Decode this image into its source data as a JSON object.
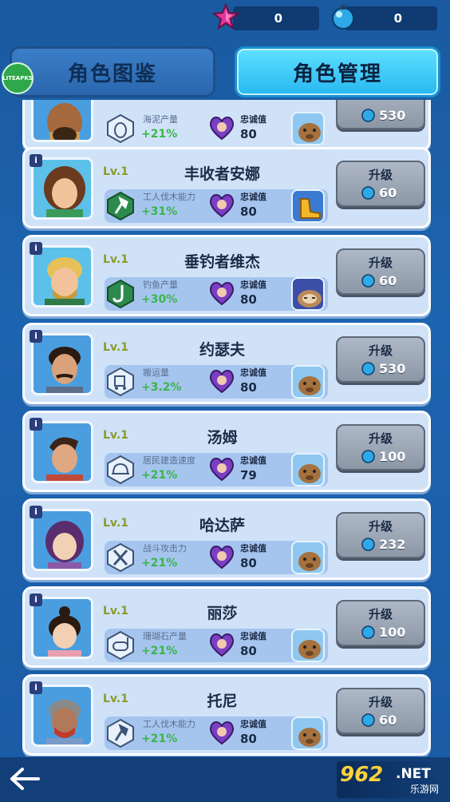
{
  "currency": {
    "stars": "0",
    "gems": "0"
  },
  "tabs": {
    "codex": "角色图鉴",
    "manage": "角色管理"
  },
  "logo": "LITEAPKS",
  "info_symbol": "i",
  "labels": {
    "loyalty": "忠诚值",
    "upgrade": "升级"
  },
  "characters": [
    {
      "level": "",
      "name": "",
      "skill": "海泥产量",
      "bonus": "+21%",
      "loyalty": "80",
      "cost": "530",
      "icon": "jar-icon",
      "pet": "capybara"
    },
    {
      "level": "Lv.1",
      "name": "丰收者安娜",
      "skill": "工人伐木能力",
      "bonus": "+31%",
      "loyalty": "80",
      "cost": "60",
      "icon": "axe-icon",
      "pet": "golden-boot"
    },
    {
      "level": "Lv.1",
      "name": "垂钓者维杰",
      "skill": "钓鱼产量",
      "bonus": "+30%",
      "loyalty": "80",
      "cost": "60",
      "icon": "fishhook-icon",
      "pet": "sloth"
    },
    {
      "level": "Lv.1",
      "name": "约瑟夫",
      "skill": "搬运量",
      "bonus": "+3.2%",
      "loyalty": "80",
      "cost": "530",
      "icon": "cart-icon",
      "pet": "capybara"
    },
    {
      "level": "Lv.1",
      "name": "汤姆",
      "skill": "居民建造速度",
      "bonus": "+21%",
      "loyalty": "79",
      "cost": "100",
      "icon": "helmet-icon",
      "pet": "capybara"
    },
    {
      "level": "Lv.1",
      "name": "哈达萨",
      "skill": "战斗攻击力",
      "bonus": "+21%",
      "loyalty": "80",
      "cost": "232",
      "icon": "swords-icon",
      "pet": "capybara"
    },
    {
      "level": "Lv.1",
      "name": "丽莎",
      "skill": "珊瑚石产量",
      "bonus": "+21%",
      "loyalty": "80",
      "cost": "100",
      "icon": "snorkel-icon",
      "pet": "capybara"
    },
    {
      "level": "Lv.1",
      "name": "托尼",
      "skill": "工人伐木能力",
      "bonus": "+21%",
      "loyalty": "80",
      "cost": "60",
      "icon": "axe-icon",
      "pet": "capybara"
    }
  ],
  "watermark": {
    "brand": "962",
    "suffix": ".NET",
    "sub": "乐游网"
  },
  "colors": {
    "bonus": "#3bb54a",
    "level": "#8a9b2a",
    "active_tab": "#27b8f0"
  }
}
